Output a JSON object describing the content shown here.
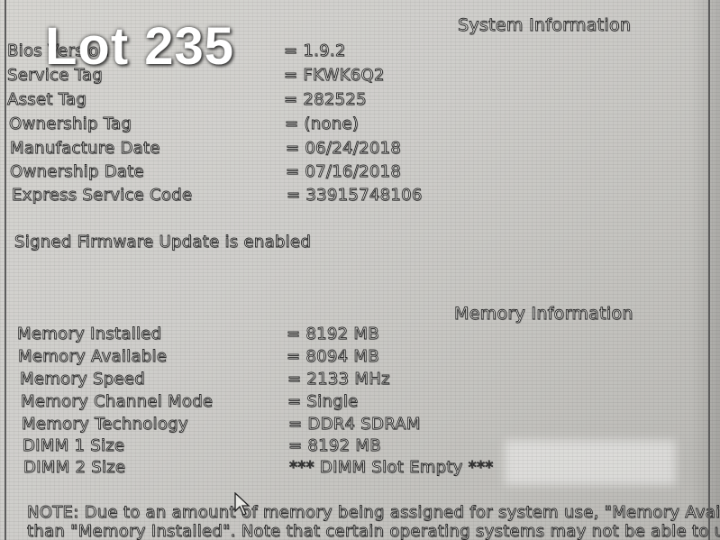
{
  "watermark": "Lot 235",
  "system_section": {
    "title": "System Information",
    "rows": [
      {
        "label": "Bios Version",
        "value": "= 1.9.2"
      },
      {
        "label": "Service Tag",
        "value": "= FKWK6Q2"
      },
      {
        "label": "Asset Tag",
        "value": "= 282525"
      },
      {
        "label": "Ownership Tag",
        "value": "= (none)"
      },
      {
        "label": "Manufacture Date",
        "value": "= 06/24/2018"
      },
      {
        "label": "Ownership Date",
        "value": "= 07/16/2018"
      },
      {
        "label": "Express Service Code",
        "value": "= 33915748106"
      }
    ],
    "firmware_note": "Signed Firmware Update is enabled"
  },
  "memory_section": {
    "title": "Memory Information",
    "rows": [
      {
        "label": "Memory Installed",
        "value": "= 8192 MB"
      },
      {
        "label": "Memory Available",
        "value": "= 8094 MB"
      },
      {
        "label": "Memory Speed",
        "value": "= 2133 MHz"
      },
      {
        "label": "Memory Channel Mode",
        "value": "= Single"
      },
      {
        "label": "Memory Technology",
        "value": "= DDR4 SDRAM"
      },
      {
        "label": "DIMM 1 Size",
        "value": "= 8192 MB"
      },
      {
        "label": "DIMM 2 Size",
        "value": "*** DIMM Slot Empty ***"
      }
    ],
    "note_line1": "NOTE: Due to an amount of memory being assigned for system use, \"Memory Available\" is less",
    "note_line2": "than \"Memory Installed\". Note that certain operating systems may not be able to use all"
  },
  "icons": {
    "cursor": "mouse-pointer-icon"
  }
}
